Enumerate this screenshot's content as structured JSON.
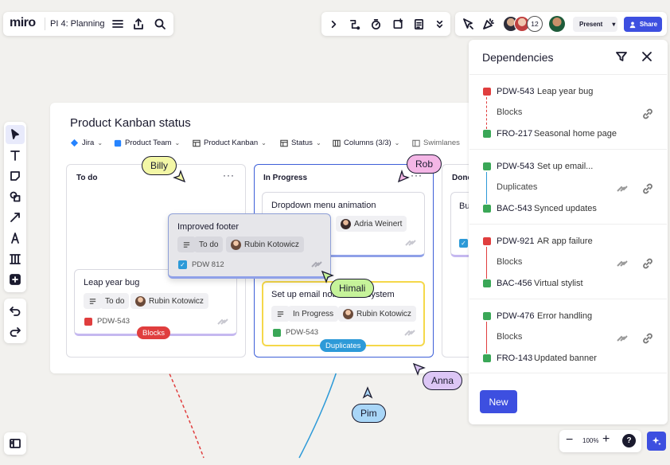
{
  "topbar": {
    "logo": "miro",
    "board_name": "PI 4: Planning",
    "collab_count": "12",
    "present_label": "Present",
    "share_label": "Share"
  },
  "board": {
    "title": "Product Kanban status",
    "filters": [
      "Jira",
      "Product Team",
      "Product Kanban",
      "Status",
      "Columns (3/3)",
      "Swimlanes"
    ],
    "columns": [
      {
        "name": "To do"
      },
      {
        "name": "In Progress"
      },
      {
        "name": "Done"
      }
    ]
  },
  "cards": {
    "dragged": {
      "title": "Improved footer",
      "status": "To do",
      "assignee": "Rubin Kotowicz",
      "id": "PDW 812"
    },
    "leap": {
      "title": "Leap year bug",
      "status": "To do",
      "assignee": "Rubin Kotowicz",
      "id": "PDW-543"
    },
    "dropdown": {
      "title": "Dropdown menu animation",
      "assignee": "Adria Weinert"
    },
    "email": {
      "title": "Set up email notification system",
      "status": "In Progress",
      "assignee": "Rubin Kotowicz",
      "id": "PDW-543"
    },
    "done": {
      "title": "Bu"
    }
  },
  "tags": {
    "blocks": "Blocks",
    "duplicates": "Duplicates"
  },
  "cursors": [
    "Billy",
    "Rob",
    "Himali",
    "Anna",
    "Pim"
  ],
  "dependencies": {
    "title": "Dependencies",
    "items": [
      {
        "from_id": "PDW-543",
        "from_title": "Leap year bug",
        "relation": "Blocks",
        "to_id": "FRO-217",
        "to_title": "Seasonal home page"
      },
      {
        "from_id": "PDW-543",
        "from_title": "Set up email...",
        "relation": "Duplicates",
        "to_id": "BAC-543",
        "to_title": "Synced updates"
      },
      {
        "from_id": "PDW-921",
        "from_title": "AR app failure",
        "relation": "Blocks",
        "to_id": "BAC-456",
        "to_title": "Virtual stylist"
      },
      {
        "from_id": "PDW-476",
        "from_title": "Error handling",
        "relation": "Blocks",
        "to_id": "FRO-143",
        "to_title": "Updated banner"
      }
    ],
    "new_label": "New"
  },
  "zoom": {
    "level": "100%"
  },
  "colors": {
    "accent": "#3d4fe0",
    "blocks": "#e03e3e",
    "duplicates": "#2d9ad8",
    "in_progress_border": "#3d5fd8"
  }
}
